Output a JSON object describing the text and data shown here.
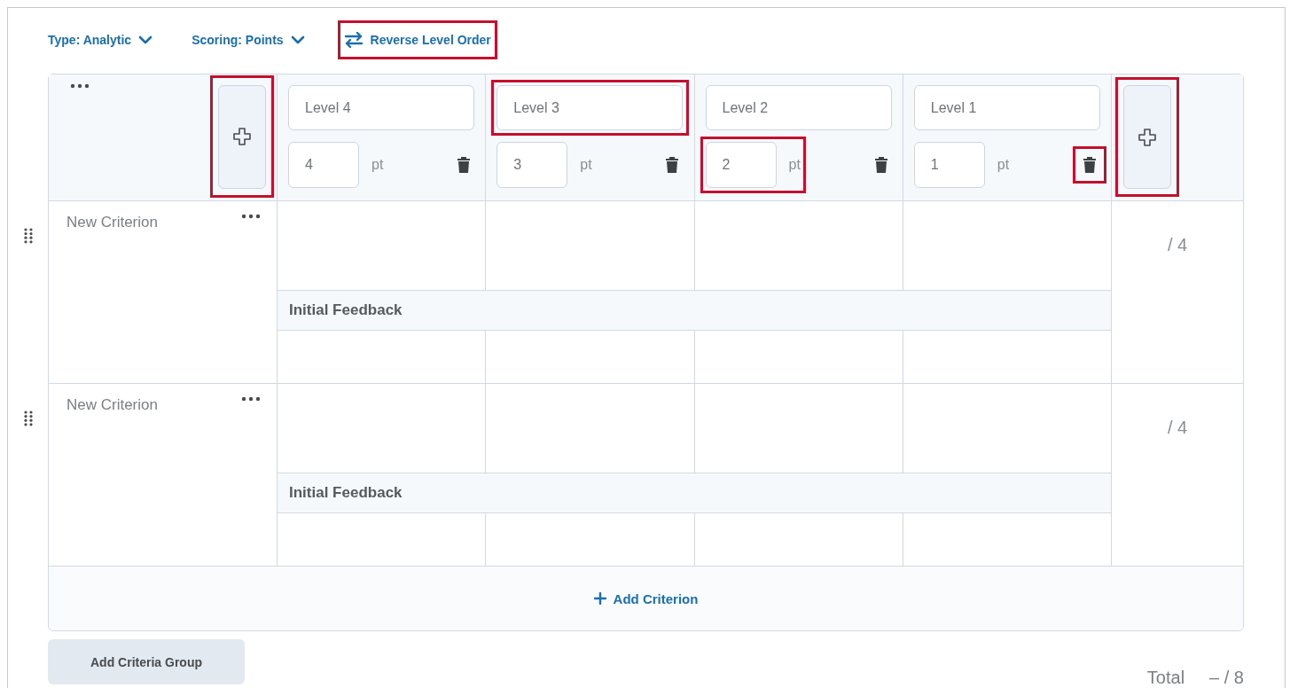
{
  "toolbar": [
    {
      "kind": "dropdown",
      "label": "Type: Analytic",
      "highlighted": false
    },
    {
      "kind": "dropdown",
      "label": "Scoring: Points",
      "highlighted": false
    },
    {
      "kind": "action",
      "label": "Reverse Level Order",
      "highlighted": true
    }
  ],
  "add_level_buttons": [
    {
      "highlighted": true
    },
    {
      "highlighted": true
    }
  ],
  "levels": [
    {
      "name": "Level 4",
      "points": "4",
      "unit": "pt",
      "name_highlighted": false,
      "points_highlighted": false,
      "delete_highlighted": false
    },
    {
      "name": "Level 3",
      "points": "3",
      "unit": "pt",
      "name_highlighted": true,
      "points_highlighted": false,
      "delete_highlighted": false
    },
    {
      "name": "Level 2",
      "points": "2",
      "unit": "pt",
      "name_highlighted": false,
      "points_highlighted": true,
      "delete_highlighted": false
    },
    {
      "name": "Level 1",
      "points": "1",
      "unit": "pt",
      "name_highlighted": false,
      "points_highlighted": false,
      "delete_highlighted": true
    }
  ],
  "criteria": [
    {
      "name": "New Criterion",
      "feedback_label": "Initial Feedback",
      "out_of": "/ 4"
    },
    {
      "name": "New Criterion",
      "feedback_label": "Initial Feedback",
      "out_of": "/ 4"
    }
  ],
  "add_criterion": "Add Criterion",
  "add_criteria_group": "Add Criteria Group",
  "total": {
    "label": "Total",
    "value": "– / 8"
  }
}
